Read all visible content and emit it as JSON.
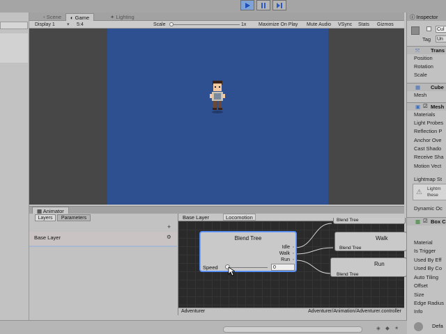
{
  "toolbar": {
    "buttons": [
      "play-icon",
      "pause-icon",
      "step-icon"
    ],
    "active": "play"
  },
  "scene_tabs": [
    {
      "label": "Scene"
    },
    {
      "label": "Game"
    },
    {
      "label": "Lighting"
    }
  ],
  "game_toolbar": {
    "display": "Display 1",
    "aspect": "5:4",
    "scale_label": "Scale",
    "scale_value": "1x",
    "maximize": "Maximize On Play",
    "mute": "Mute Audio",
    "vsync": "VSync",
    "stats": "Stats",
    "gizmos": "Gizmos"
  },
  "animator": {
    "tab_title": "Animator",
    "left_tabs": [
      "Layers",
      "Parameters"
    ],
    "layer_name": "Base Layer",
    "breadcrumbs": [
      "Base Layer",
      "Locomotion"
    ],
    "blend_tree": {
      "title": "Blend Tree",
      "outputs": [
        "Idle",
        "Walk",
        "Run"
      ],
      "param_label": "Speed",
      "param_value": "0"
    },
    "child_nodes": [
      {
        "label": "Walk",
        "sub": "Blend Tree"
      },
      {
        "label": "Run",
        "sub": "Blend Tree"
      }
    ],
    "top_child_sub": "Blend Tree",
    "status_left": "Adventurer",
    "status_right": "Adventurer/Animation/Adventurer.controller"
  },
  "inspector": {
    "tab_title": "Inspector",
    "object_name": "Cul",
    "tag_label": "Tag",
    "tag_value": "Un",
    "transform_header": "Trans",
    "transform_fields": [
      "Position",
      "Rotation",
      "Scale"
    ],
    "cube_header": "Cube",
    "cube_fields": [
      "Mesh"
    ],
    "mesh_header": "Mesh",
    "mesh_fields": [
      "Materials",
      "Light Probes",
      "Reflection P",
      "Anchor Ove",
      "Cast Shado",
      "Receive Sha",
      "Motion Vect"
    ],
    "lightmap_label": "Lightmap St",
    "lightmap_note_1": "Lightm",
    "lightmap_note_2": "these",
    "dynamic_label": "Dynamic Oc",
    "box_header": "Box C",
    "box_fields": [
      "Material",
      "Is Trigger",
      "Used By Eff",
      "Used By Co",
      "Auto Tiling",
      "Offset",
      "Size",
      "Edge Radius",
      "Info"
    ],
    "footer_label": "Defa"
  },
  "colors": {
    "viewport": "#2e5090",
    "graph_bg": "#2a2a2a",
    "selection": "#4b83e8"
  }
}
